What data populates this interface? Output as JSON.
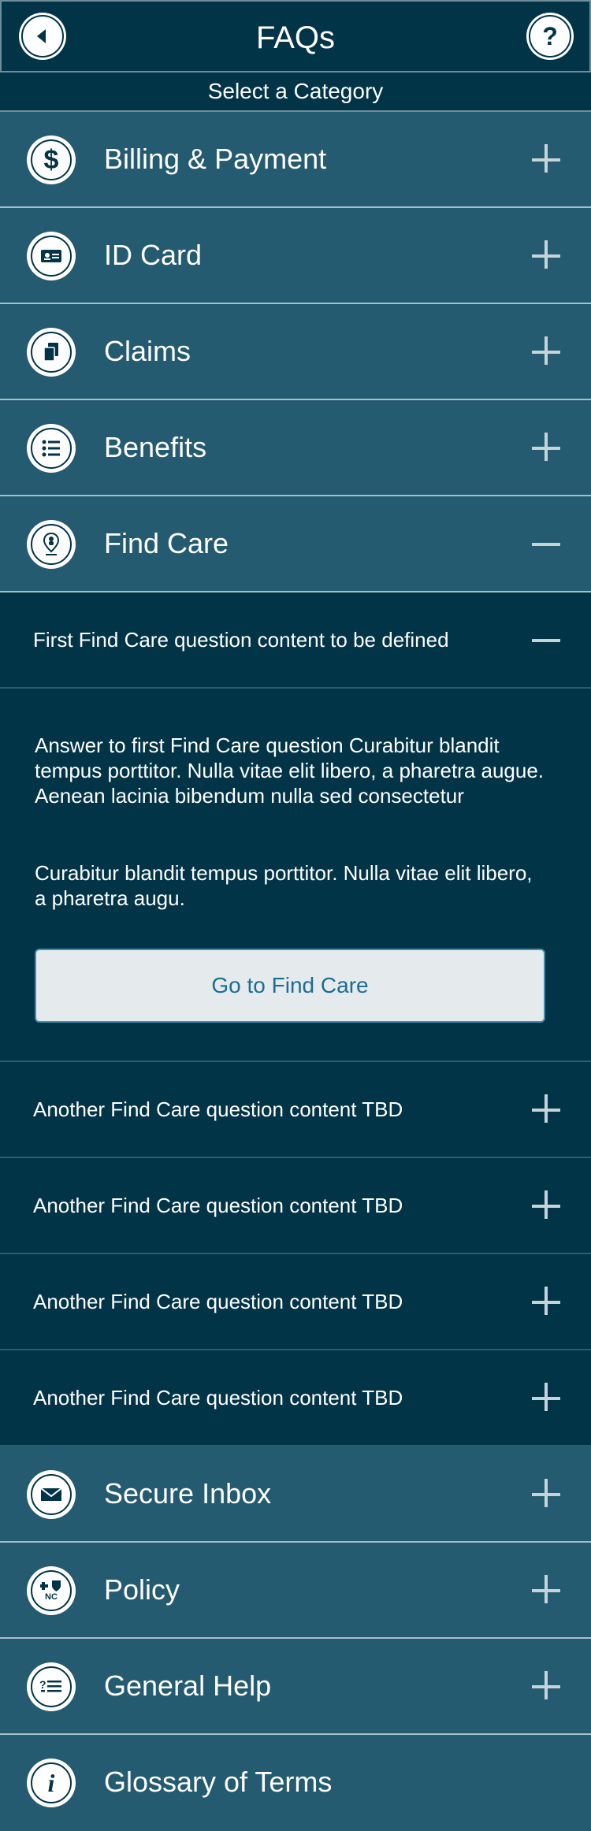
{
  "header": {
    "title": "FAQs",
    "back_icon": "back-arrow-icon",
    "help_icon": "question-mark-icon",
    "help_glyph": "?"
  },
  "subheader": {
    "text": "Select a Category"
  },
  "categories": [
    {
      "label": "Billing & Payment",
      "icon": "dollar-icon",
      "glyph": "$",
      "expanded": false
    },
    {
      "label": "ID Card",
      "icon": "id-card-icon",
      "expanded": false
    },
    {
      "label": "Claims",
      "icon": "documents-icon",
      "expanded": false
    },
    {
      "label": "Benefits",
      "icon": "list-icon",
      "expanded": false
    },
    {
      "label": "Find Care",
      "icon": "location-pin-icon",
      "expanded": true
    },
    {
      "label": "Secure Inbox",
      "icon": "envelope-icon",
      "expanded": false
    },
    {
      "label": "Policy",
      "icon": "bcbs-nc-logo-icon",
      "glyph": "NC",
      "expanded": false
    },
    {
      "label": "General Help",
      "icon": "question-list-icon",
      "expanded": false
    },
    {
      "label": "Glossary of Terms",
      "icon": "info-icon",
      "glyph": "i",
      "expanded": false
    }
  ],
  "find_care": {
    "questions": [
      {
        "text": "First Find Care question content to be defined",
        "expanded": true
      },
      {
        "text": "Another Find Care question content TBD",
        "expanded": false
      },
      {
        "text": "Another Find Care question content TBD",
        "expanded": false
      },
      {
        "text": "Another Find Care question content TBD",
        "expanded": false
      },
      {
        "text": "Another Find Care question content TBD",
        "expanded": false
      }
    ],
    "answer": {
      "paragraph1": "Answer to first Find Care question Curabitur blandit tempus porttitor. Nulla vitae elit libero, a pharetra augue. Aenean lacinia bibendum nulla sed consectetur",
      "paragraph2": "Curabitur blandit tempus porttitor. Nulla vitae elit libero, a pharetra augu.",
      "button_label": "Go to Find Care"
    }
  },
  "colors": {
    "navy": "#023448",
    "category_bg": "#245b70",
    "divider": "#a8bfc8",
    "button_bg": "#e5eaec",
    "button_text": "#1b6d92"
  }
}
